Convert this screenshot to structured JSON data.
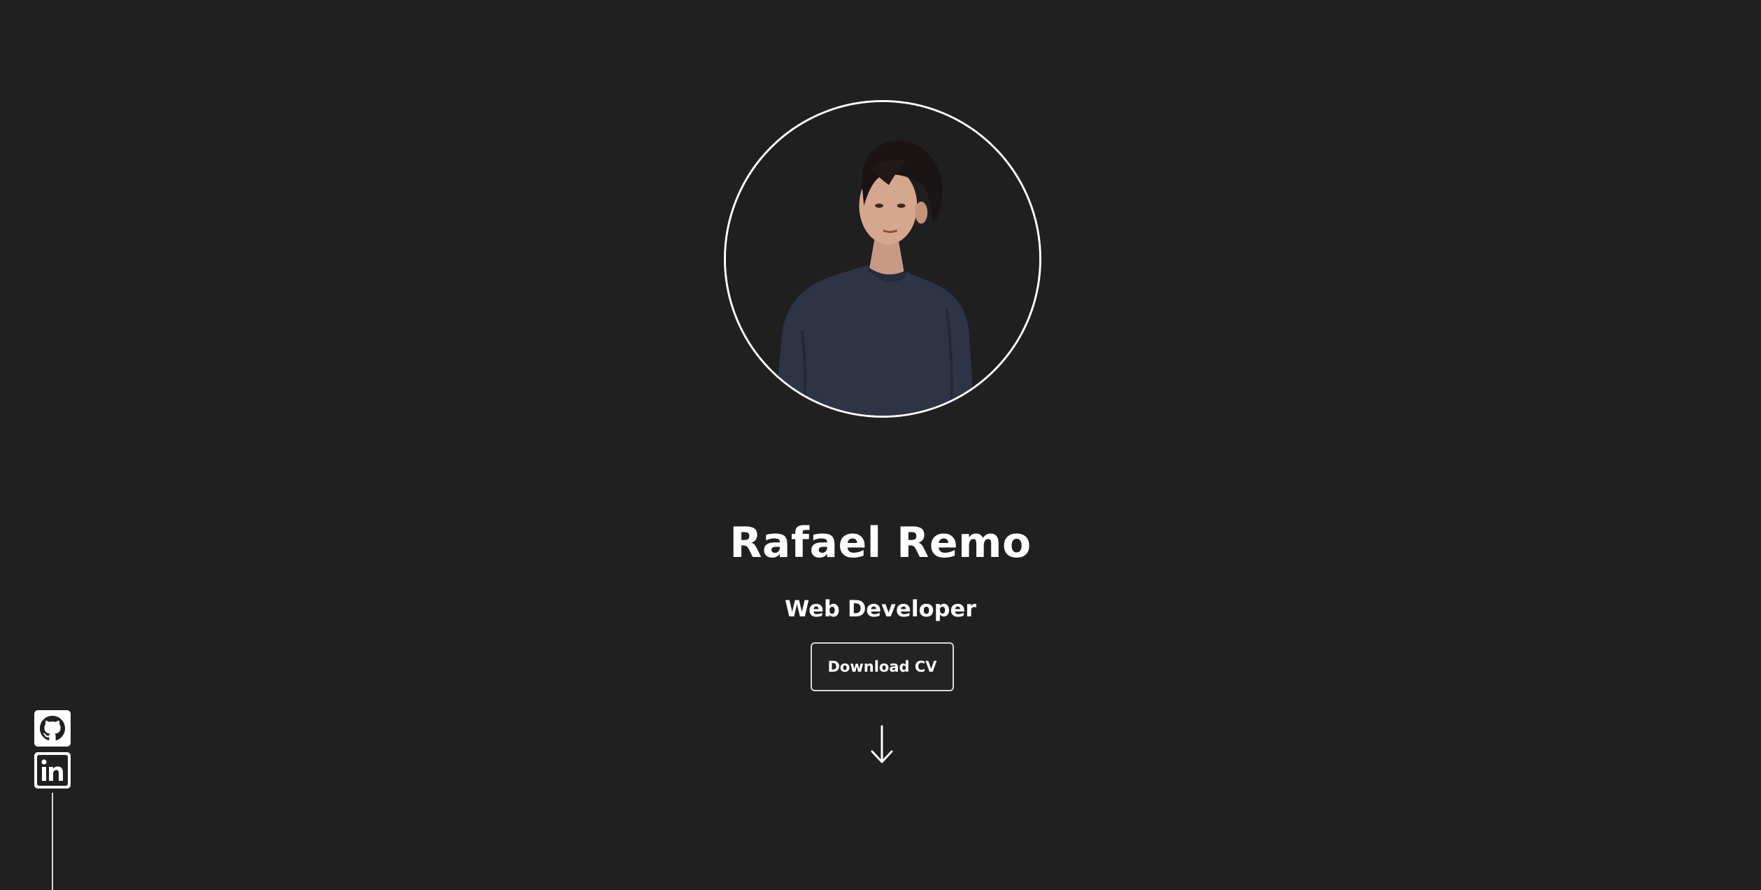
{
  "hero": {
    "name": "Rafael Remo",
    "role": "Web Developer",
    "cv_button_label": "Download CV",
    "scroll_icon": "arrow-down-icon",
    "avatar_icon": "profile-photo"
  },
  "social": {
    "links": [
      {
        "icon": "github-icon"
      },
      {
        "icon": "linkedin-icon"
      }
    ]
  },
  "colors": {
    "background": "#202020",
    "text": "#ffffff",
    "border": "#ffffff"
  }
}
